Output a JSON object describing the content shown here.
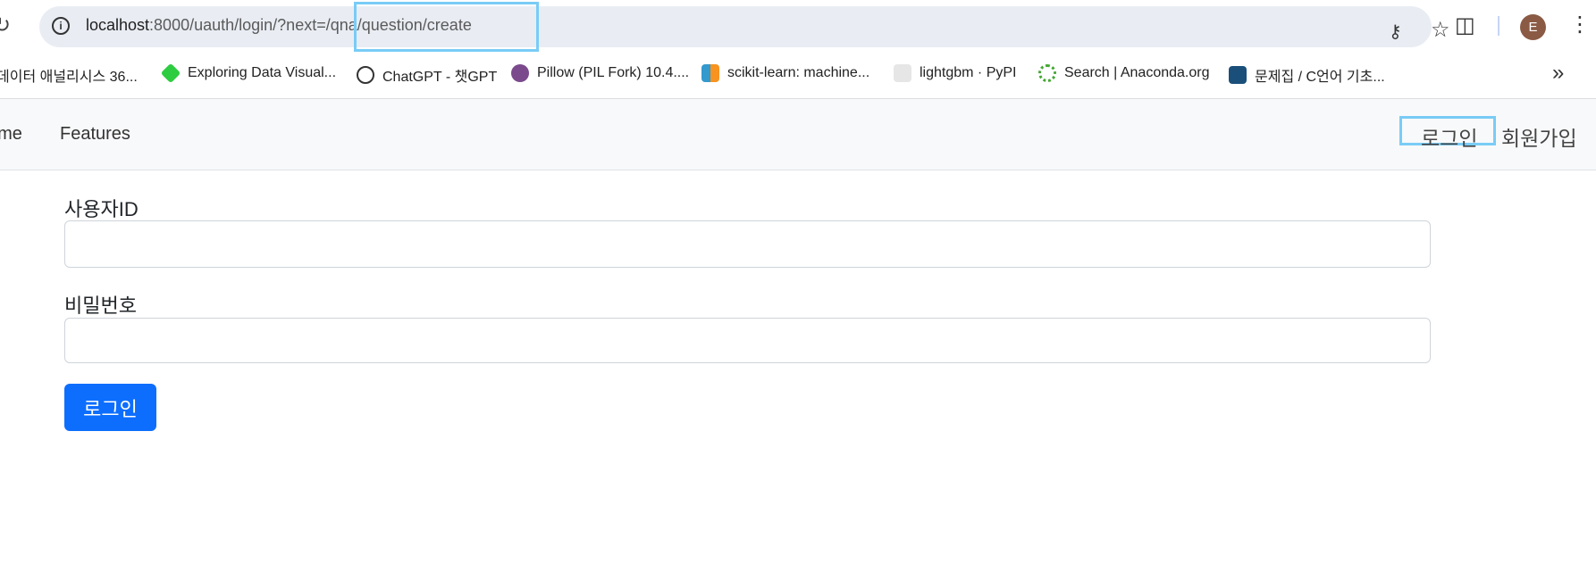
{
  "browser": {
    "url_host": "localhost",
    "url_rest": ":8000/uauth/login/?next=/qna/question/create",
    "avatar_letter": "E"
  },
  "bookmarks": [
    {
      "label": "데이터 애널리시스 36...",
      "icon_color": ""
    },
    {
      "label": "Exploring Data Visual...",
      "icon_color": "#2ecc40"
    },
    {
      "label": "ChatGPT - 챗GPT",
      "icon_color": "#333333"
    },
    {
      "label": "Pillow (PIL Fork) 10.4....",
      "icon_color": "#7a4a8c"
    },
    {
      "label": "scikit-learn: machine...",
      "icon_color": "#f7931e"
    },
    {
      "label": "lightgbm · PyPI",
      "icon_color": "#e6e6e6"
    },
    {
      "label": "Search | Anaconda.org",
      "icon_color": "#44a833"
    },
    {
      "label": "문제집 / C언어 기초...",
      "icon_color": "#1a4f7a"
    }
  ],
  "navbar": {
    "home": "ome",
    "features": "Features",
    "login": "로그인",
    "signup": "회원가입"
  },
  "form": {
    "user_id_label": "사용자ID",
    "user_id_value": "",
    "password_label": "비밀번호",
    "password_value": "",
    "submit_label": "로그인"
  },
  "colors": {
    "primary": "#0d6efd",
    "highlight": "#79ccf6"
  }
}
